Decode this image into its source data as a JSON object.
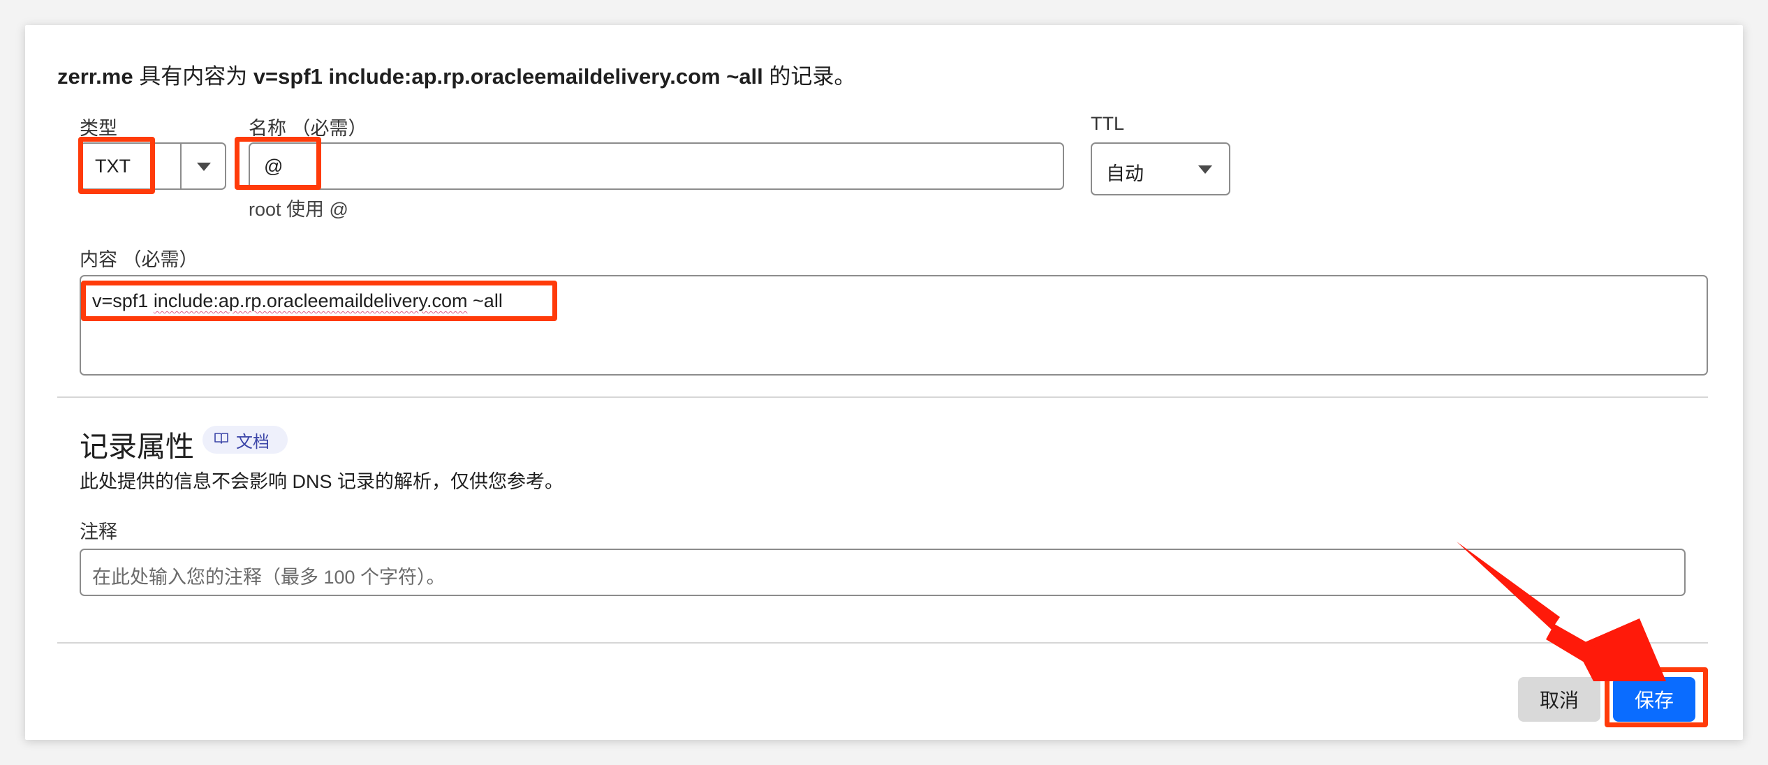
{
  "headline": {
    "domain": "zerr.me",
    "text1": " 具有内容为 ",
    "record": "v=spf1 include:ap.rp.oracleemaildelivery.com ~all",
    "text2": " 的记录。"
  },
  "form": {
    "type_label": "类型",
    "type_value": "TXT",
    "name_label": "名称 （必需）",
    "name_value": "@",
    "name_hint": "root 使用 @",
    "ttl_label": "TTL",
    "ttl_value": "自动",
    "content_label": "内容 （必需）",
    "content_value_prefix": "v=spf1 ",
    "content_value_main": "include:ap.rp.oracleemaildelivery.com",
    "content_value_suffix": " ~all"
  },
  "record_properties": {
    "title": "记录属性",
    "docs_label": "文档",
    "description": "此处提供的信息不会影响 DNS 记录的解析，仅供您参考。",
    "comment_label": "注释",
    "comment_placeholder": "在此处输入您的注释（最多 100 个字符）。"
  },
  "actions": {
    "cancel_label": "取消",
    "save_label": "保存"
  },
  "colors": {
    "highlight": "#ff3b0a",
    "save_button": "#0a6cff",
    "arrow": "#ff1a0a"
  },
  "icons": {
    "docs": "book-icon",
    "dropdown": "caret-down-icon"
  }
}
